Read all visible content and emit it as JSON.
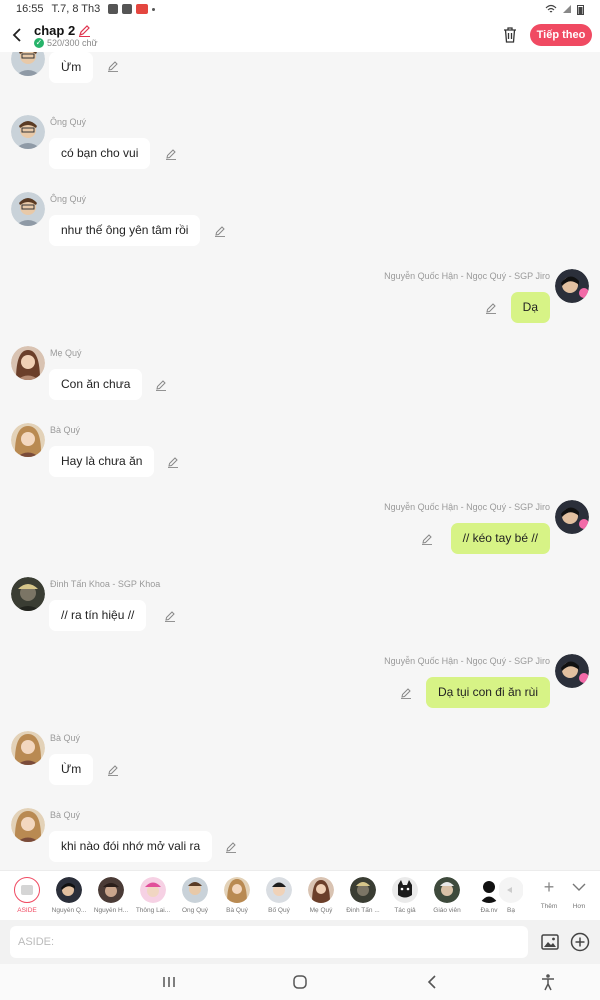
{
  "status_bar": {
    "time": "16:55",
    "date": "T.7, 8 Th3"
  },
  "header": {
    "title": "chap 2",
    "word_count": "520/300 chữ",
    "next_label": "Tiếp theo"
  },
  "messages": [
    {
      "side": "left",
      "sender": "",
      "text": "Ừm",
      "avatar": "ong-quy"
    },
    {
      "side": "left",
      "sender": "Ông Quý",
      "text": "có bạn cho vui",
      "avatar": "ong-quy"
    },
    {
      "side": "left",
      "sender": "Ông Quý",
      "text": "như thế ông yên tâm rồi",
      "avatar": "ong-quy"
    },
    {
      "side": "right",
      "sender": "Nguyễn Quốc Hận - Ngọc Quý - SGP Jiro",
      "text": "Dạ",
      "avatar": "jiro"
    },
    {
      "side": "left",
      "sender": "Mẹ Quý",
      "text": "Con ăn chưa",
      "avatar": "me-quy"
    },
    {
      "side": "left",
      "sender": "Bà Quý",
      "text": "Hay là chưa ăn",
      "avatar": "ba-quy"
    },
    {
      "side": "right",
      "sender": "Nguyễn Quốc Hận - Ngọc Quý - SGP Jiro",
      "text": "// kéo tay bé //",
      "avatar": "jiro"
    },
    {
      "side": "left",
      "sender": "Đinh Tấn Khoa - SGP Khoa",
      "text": "// ra tín hiệu //",
      "avatar": "khoa"
    },
    {
      "side": "right",
      "sender": "Nguyễn Quốc Hận - Ngọc Quý - SGP Jiro",
      "text": "Dạ tụi con đi ăn rùi",
      "avatar": "jiro"
    },
    {
      "side": "left",
      "sender": "Bà Quý",
      "text": "Ừm",
      "avatar": "ba-quy"
    },
    {
      "side": "left",
      "sender": "Bà Quý",
      "text": "khi nào đói nhớ mở vali ra",
      "avatar": "ba-quy"
    }
  ],
  "characters": [
    {
      "name": "ASIDE",
      "avatar": "aside",
      "active": true
    },
    {
      "name": "Nguyễn Q...",
      "avatar": "jiro"
    },
    {
      "name": "Nguyễn H...",
      "avatar": "nguyen-h"
    },
    {
      "name": "Thông Lai...",
      "avatar": "thong-lai"
    },
    {
      "name": "Ông Quý",
      "avatar": "ong-quy"
    },
    {
      "name": "Bà Quý",
      "avatar": "ba-quy"
    },
    {
      "name": "Bố Quý",
      "avatar": "bo-quy"
    },
    {
      "name": "Mẹ Quý",
      "avatar": "me-quy"
    },
    {
      "name": "Đinh Tấn ...",
      "avatar": "khoa"
    },
    {
      "name": "Tác giả",
      "avatar": "tac-gia"
    },
    {
      "name": "Giáo viên",
      "avatar": "giao-vien"
    },
    {
      "name": "Đa.nv",
      "avatar": "da-nv"
    },
    {
      "name": "Bạ",
      "avatar": "partial"
    }
  ],
  "char_actions": {
    "add_label": "Thêm",
    "more_label": "Hơn"
  },
  "input": {
    "placeholder": "ASIDE:"
  },
  "icons": {
    "back": "back-arrow-icon",
    "edit_title": "pencil-icon",
    "trash": "trash-icon",
    "edit_message": "pencil-icon",
    "image": "image-icon",
    "add": "plus-circle-icon",
    "nav_recent": "recent-apps-icon",
    "nav_home": "home-icon",
    "nav_back": "back-icon",
    "nav_accessibility": "accessibility-icon"
  },
  "colors": {
    "accent": "#f04a62",
    "right_bubble": "#d7f386",
    "left_bubble": "#ffffff",
    "background": "#f6f6f6"
  }
}
